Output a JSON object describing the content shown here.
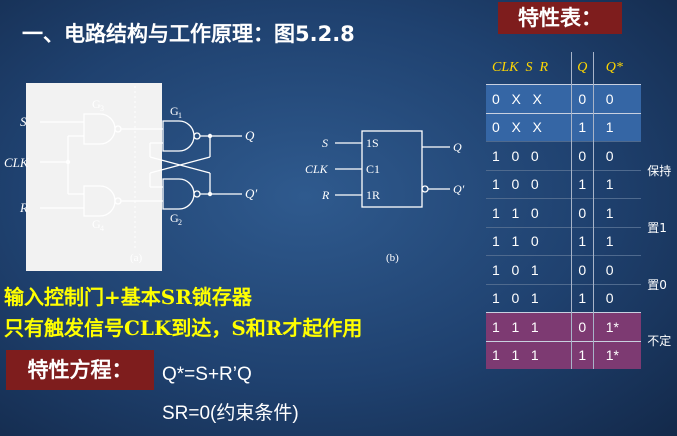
{
  "title": "一、电路结构与工作原理：图5.2.8",
  "circuit_a": {
    "labels": {
      "s": "S",
      "clk": "CLK",
      "r": "R",
      "q": "Q",
      "qp": "Q′",
      "g3": "G",
      "g3sub": "3",
      "g1": "G",
      "g1sub": "1",
      "g4": "G",
      "g4sub": "4",
      "g2": "G",
      "g2sub": "2",
      "caption": "(a)"
    }
  },
  "circuit_b": {
    "labels": {
      "s": "S",
      "clk": "CLK",
      "r": "R",
      "q": "Q",
      "qp": "Q′",
      "pin1": "1S",
      "pin2": "C1",
      "pin3": "1R",
      "caption": "(b)"
    }
  },
  "table": {
    "title": "特性表：",
    "headers": {
      "inputs": "CLK  S  R",
      "q": "Q",
      "qs": "Q*"
    },
    "rows": [
      {
        "inputs": "0   X   X",
        "q": "0",
        "qs": "0",
        "style": "blue"
      },
      {
        "inputs": "0   X   X",
        "q": "1",
        "qs": "1",
        "style": "blue"
      },
      {
        "inputs": "1   0   0",
        "q": "0",
        "qs": "0",
        "style": "plain"
      },
      {
        "inputs": "1   0   0",
        "q": "1",
        "qs": "1",
        "style": "plain"
      },
      {
        "inputs": "1   1   0",
        "q": "0",
        "qs": "1",
        "style": "plain"
      },
      {
        "inputs": "1   1   0",
        "q": "1",
        "qs": "1",
        "style": "plain"
      },
      {
        "inputs": "1   0   1",
        "q": "0",
        "qs": "0",
        "style": "plain"
      },
      {
        "inputs": "1   0   1",
        "q": "1",
        "qs": "0",
        "style": "plain"
      },
      {
        "inputs": "1   1   1",
        "q": "0",
        "qs": "1*",
        "style": "purple"
      },
      {
        "inputs": "1   1   1",
        "q": "1",
        "qs": "1*",
        "style": "purple"
      }
    ],
    "notes": [
      "保持",
      "置1",
      "置0",
      "不定"
    ]
  },
  "desc_line1": "输入控制门+基本SR锁存器",
  "desc_line2": "只有触发信号CLK到达，S和R才起作用",
  "eq_title": "特性方程：",
  "eq_line1": "Q*=S+R’Q",
  "eq_line2": "SR=0(约束条件)"
}
